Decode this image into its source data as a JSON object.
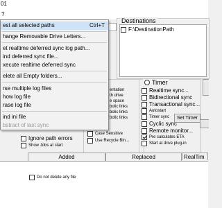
{
  "window": {
    "title_fragment": "01"
  },
  "menubar": {
    "help": "?"
  },
  "menu": {
    "items": [
      {
        "label": "est all selected paths",
        "shortcut": "Ctrl+T"
      },
      {
        "label": "hange Removable Drive Letters..."
      },
      {
        "label": "et realtime deferred sync log path..."
      },
      {
        "label": "ind deferred sync file..."
      },
      {
        "label": "xecute realtime deferred sync"
      },
      {
        "label": "elete all Empty folders..."
      },
      {
        "label": "rse multiple log files"
      },
      {
        "label": "how log file"
      },
      {
        "label": "rase log file"
      },
      {
        "label": "ind ini file"
      },
      {
        "label": "bstract of last sync"
      }
    ]
  },
  "destinations": {
    "label": "Destinations",
    "item": "F:\\DestinationPath",
    "item_checked": false
  },
  "options": {
    "items": [
      "entation",
      "th drive",
      "e space",
      "bolic links",
      "bolic links",
      "bolic links",
      "CL",
      "Case Sensitive",
      "Use Recycle Bin..."
    ],
    "ignore_path_errors": "Ignore path errors",
    "show_jobs_at_start": "Show Jobs at start"
  },
  "timer": {
    "label": "Timer",
    "items": [
      {
        "label": "Realtime sync...",
        "checked": false,
        "size": "big"
      },
      {
        "label": "Bidirectional sync",
        "checked": false,
        "size": "big"
      },
      {
        "label": "Transactional sync...",
        "checked": false,
        "size": "big"
      },
      {
        "label": "Autostart",
        "checked": false,
        "size": "small"
      },
      {
        "label": "Timer sync",
        "checked": false,
        "size": "small"
      },
      {
        "label": "Cyclic sync",
        "checked": false,
        "size": "big"
      },
      {
        "label": "Remote monitor...",
        "checked": false,
        "size": "big"
      },
      {
        "label": "Pre calculates ETA",
        "checked": true,
        "size": "small"
      },
      {
        "label": "Start at drive plug-in",
        "checked": false,
        "size": "small"
      }
    ],
    "set_timer": "Set Timer"
  },
  "tabs": {
    "added": "Added",
    "replaced": "Replaced",
    "realtime": "RealTim"
  },
  "bottom": {
    "do_not_delete": "Do not delete any file"
  }
}
